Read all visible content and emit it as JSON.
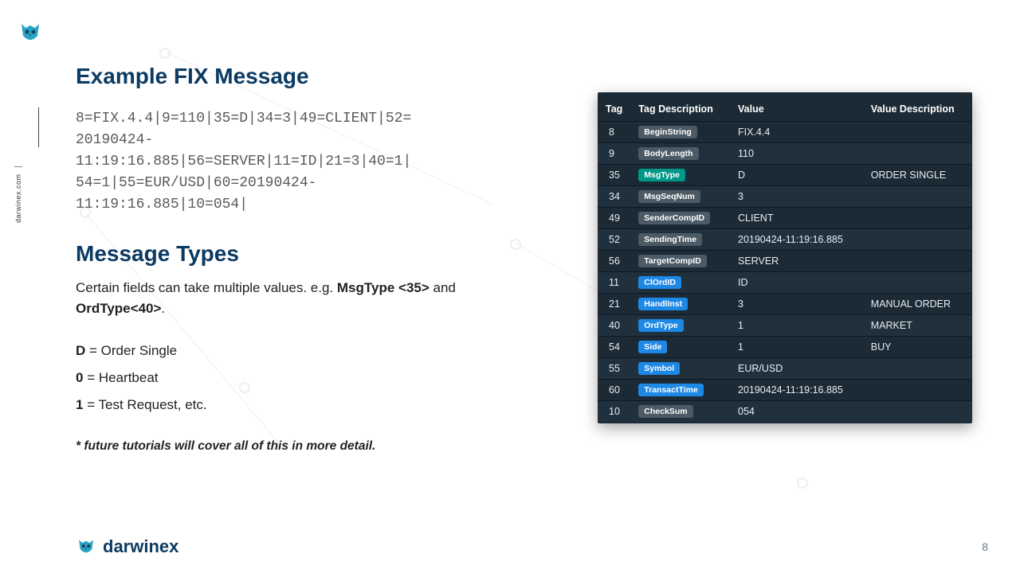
{
  "rail": {
    "site": "darwinex.com"
  },
  "headings": {
    "example": "Example FIX Message",
    "types": "Message Types"
  },
  "fix_lines": [
    "8=FIX.4.4|9=110|35=D|34=3|49=CLIENT|52=",
    "20190424-",
    "11:19:16.885|56=SERVER|11=ID|21=3|40=1|",
    "54=1|55=EUR/USD|60=20190424-",
    "11:19:16.885|10=054|"
  ],
  "types_intro": {
    "pre": "Certain fields can take multiple values. e.g. ",
    "b1": "MsgType <35>",
    "mid": " and ",
    "b2": "OrdType<40>",
    "post": "."
  },
  "type_list": [
    {
      "k": "D",
      "v": " = Order Single"
    },
    {
      "k": "0",
      "v": " = Heartbeat"
    },
    {
      "k": "1",
      "v": " = Test Request, etc."
    }
  ],
  "footnote": "* future tutorials will cover all of this in more detail.",
  "table": {
    "headers": {
      "tag": "Tag",
      "tagdesc": "Tag Description",
      "value": "Value",
      "valuedesc": "Value Description"
    },
    "rows": [
      {
        "tag": "8",
        "chip": "BeginString",
        "chipColor": "grey",
        "value": "FIX.4.4",
        "desc": ""
      },
      {
        "tag": "9",
        "chip": "BodyLength",
        "chipColor": "grey",
        "value": "110",
        "desc": ""
      },
      {
        "tag": "35",
        "chip": "MsgType",
        "chipColor": "teal",
        "value": "D",
        "desc": "ORDER SINGLE"
      },
      {
        "tag": "34",
        "chip": "MsgSeqNum",
        "chipColor": "grey",
        "value": "3",
        "desc": ""
      },
      {
        "tag": "49",
        "chip": "SenderCompID",
        "chipColor": "grey",
        "value": "CLIENT",
        "desc": ""
      },
      {
        "tag": "52",
        "chip": "SendingTime",
        "chipColor": "grey",
        "value": "20190424-11:19:16.885",
        "desc": ""
      },
      {
        "tag": "56",
        "chip": "TargetCompID",
        "chipColor": "grey",
        "value": "SERVER",
        "desc": ""
      },
      {
        "tag": "11",
        "chip": "ClOrdID",
        "chipColor": "blue",
        "value": "ID",
        "desc": ""
      },
      {
        "tag": "21",
        "chip": "HandlInst",
        "chipColor": "blue",
        "value": "3",
        "desc": "MANUAL ORDER"
      },
      {
        "tag": "40",
        "chip": "OrdType",
        "chipColor": "blue",
        "value": "1",
        "desc": "MARKET"
      },
      {
        "tag": "54",
        "chip": "Side",
        "chipColor": "blue",
        "value": "1",
        "desc": "BUY"
      },
      {
        "tag": "55",
        "chip": "Symbol",
        "chipColor": "blue",
        "value": "EUR/USD",
        "desc": ""
      },
      {
        "tag": "60",
        "chip": "TransactTime",
        "chipColor": "blue",
        "value": "20190424-11:19:16.885",
        "desc": ""
      },
      {
        "tag": "10",
        "chip": "CheckSum",
        "chipColor": "grey",
        "value": "054",
        "desc": ""
      }
    ]
  },
  "footer": {
    "brand": "darwinex",
    "page": "8"
  }
}
